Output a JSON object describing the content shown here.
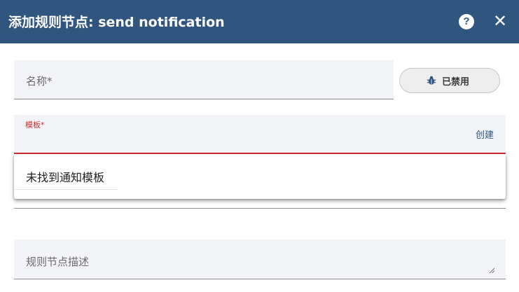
{
  "dialog": {
    "title": "添加规则节点: send notification",
    "help_icon": "help-circle-icon",
    "close_icon": "close-icon",
    "help_glyph": "?",
    "close_glyph": "✕"
  },
  "form": {
    "name_placeholder": "名称*",
    "debug_button": {
      "icon": "bug-icon",
      "label": "已禁用"
    },
    "template": {
      "label": "模板*",
      "create_link": "创建",
      "dropdown_option": "未找到通知模板"
    },
    "description_placeholder": "规则节点描述"
  },
  "colors": {
    "header_bg": "#305680",
    "error_red": "#d32f2f",
    "field_bg": "#f3f4f8"
  }
}
